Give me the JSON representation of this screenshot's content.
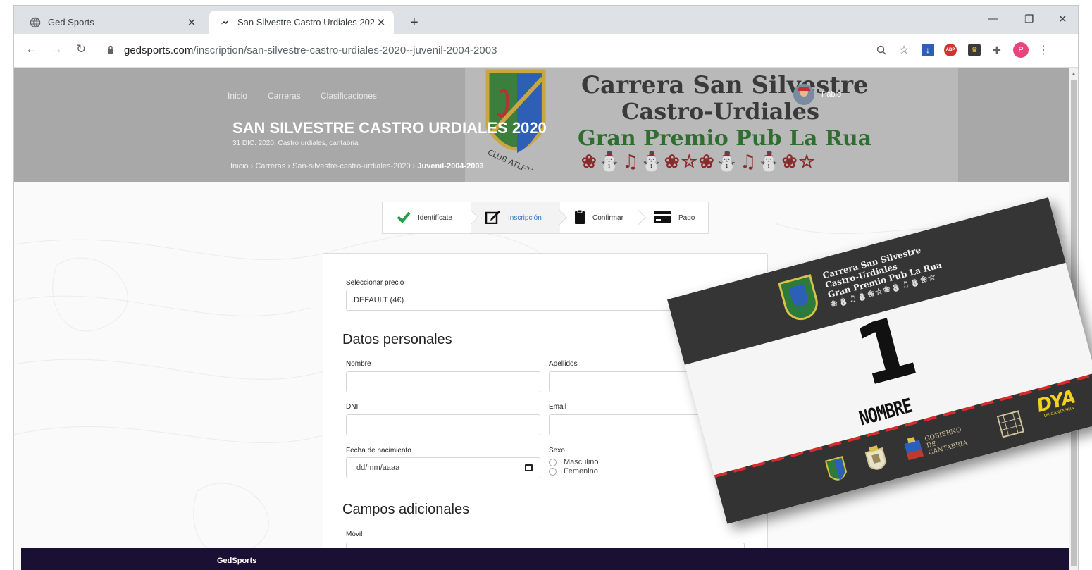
{
  "browser": {
    "tabs": [
      {
        "title": "Ged Sports",
        "active": false
      },
      {
        "title": "San Silvestre Castro Urdiales 202",
        "active": true
      }
    ],
    "url_host": "gedsports.com",
    "url_path": "/inscription/san-silvestre-castro-urdiales-2020--juvenil-2004-2003",
    "profile_initial": "P",
    "adblock_label": "ABP"
  },
  "hero": {
    "nav": [
      "Inicio",
      "Carreras",
      "Clasificaciones"
    ],
    "user_name": "Pablo",
    "title": "SAN SILVESTRE CASTRO URDIALES 2020",
    "subtitle": "31 DIC. 2020, Castro urdiales, cantabria",
    "breadcrumb": [
      "Inicio",
      "Carreras",
      "San-silvestre-castro-urdiales-2020"
    ],
    "breadcrumb_current": "Juvenil-2004-2003",
    "banner_lines": [
      "Carrera San Silvestre",
      "Castro-Urdiales",
      "Gran Premio Pub La Rua",
      "❀⛄♫⛄❀☆❀⛄♫⛄❀☆"
    ]
  },
  "steps": [
    {
      "label": "Identifícate",
      "icon": "check-icon"
    },
    {
      "label": "Inscripción",
      "icon": "edit-icon"
    },
    {
      "label": "Confirmar",
      "icon": "clipboard-icon"
    },
    {
      "label": "Pago",
      "icon": "credit-card-icon"
    }
  ],
  "form": {
    "price_label": "Seleccionar precio",
    "price_value": "DEFAULT (4€)",
    "personal_title": "Datos personales",
    "nombre_label": "Nombre",
    "apellidos_label": "Apellidos",
    "dni_label": "DNI",
    "email_label": "Email",
    "birth_label": "Fecha de nacimiento",
    "birth_placeholder": "dd/mm/aaaa",
    "sexo_label": "Sexo",
    "sexo_options": [
      "Masculino",
      "Femenino"
    ],
    "extra_title": "Campos adicionales",
    "movil_label": "Móvil"
  },
  "footer": {
    "brand": "GedSports"
  },
  "bib": {
    "title_lines": [
      "Carrera San Silvestre",
      "Castro-Urdiales",
      "Gran Premio Pub La Rua",
      "❀⛄♫⛄❀☆❀⛄♫⛄❀☆"
    ],
    "number": "1",
    "name": "NOMBRE",
    "sponsor_gob": "GOBIERNO DE CANTABRIA",
    "sponsor_rua": "LA RUA",
    "sponsor_dya": "DYA",
    "sponsor_dya_sub": "DE CANTABRIA"
  },
  "colors": {
    "footer_bg": "#1a1033",
    "hero_bg": "#a8a8a8",
    "active_step": "#3a76c4",
    "check_green": "#22a045"
  }
}
